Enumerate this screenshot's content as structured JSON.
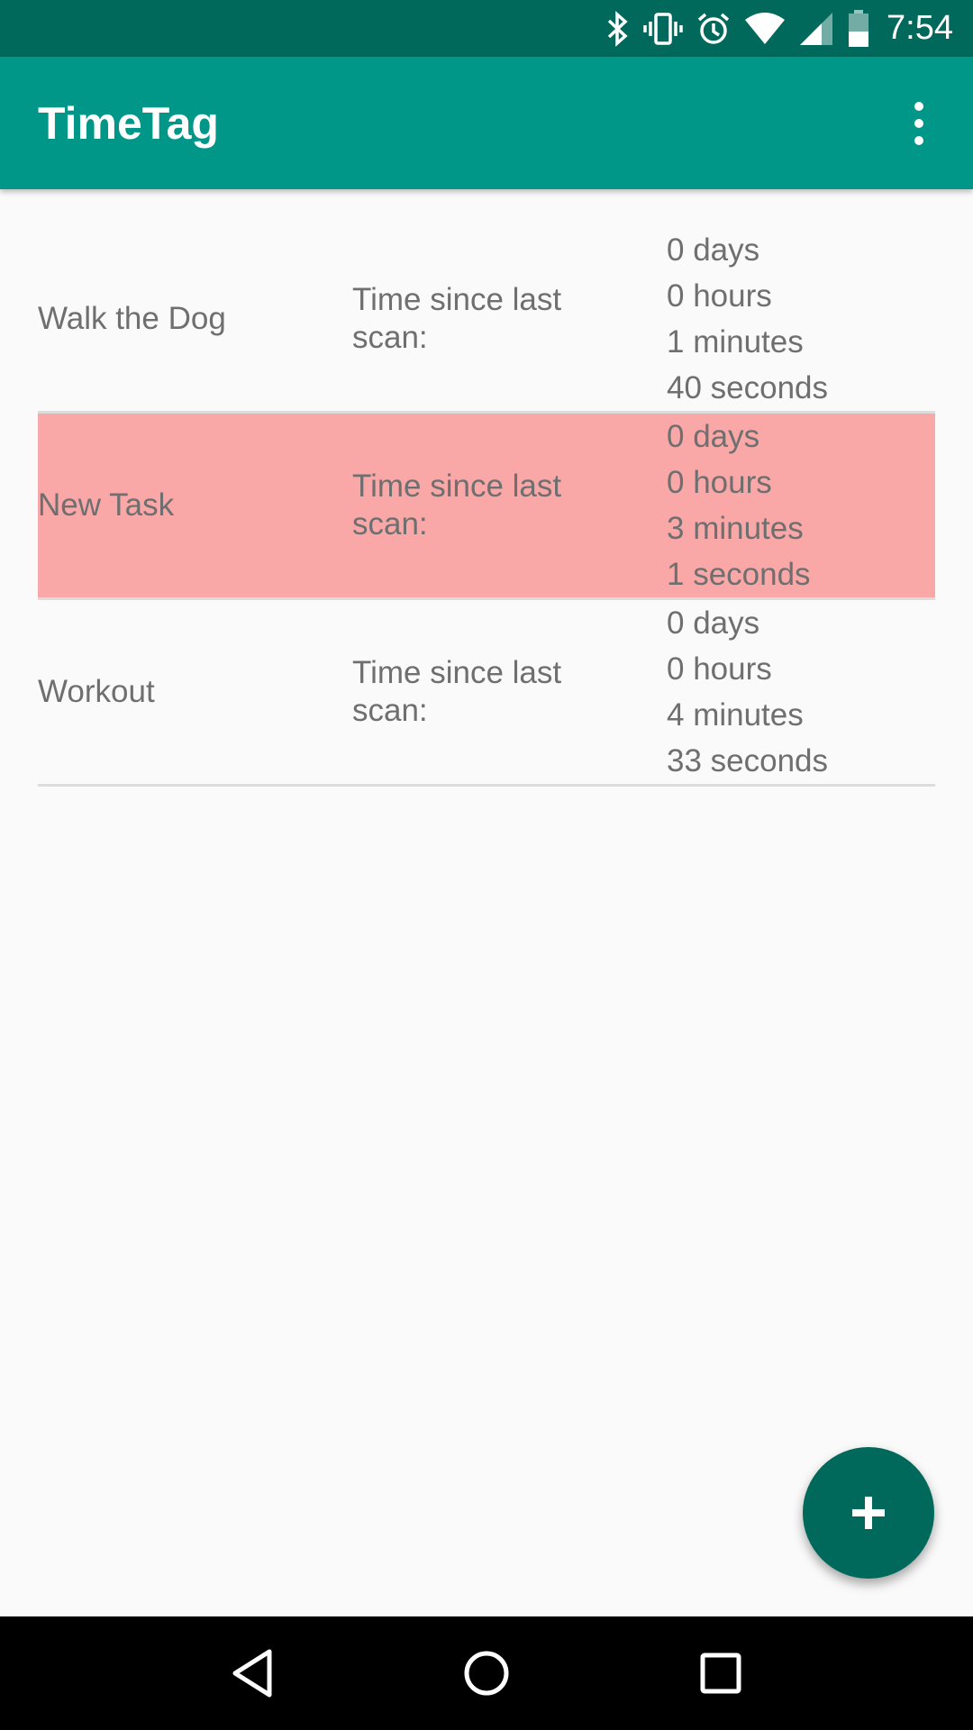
{
  "status_bar": {
    "time": "7:54",
    "icons": [
      "bluetooth-icon",
      "vibrate-icon",
      "alarm-icon",
      "wifi-icon",
      "cell-signal-icon",
      "battery-icon"
    ]
  },
  "app_bar": {
    "title": "TimeTag",
    "menu_icon": "overflow-menu-icon"
  },
  "tasks": [
    {
      "name": "Walk the Dog",
      "label": "Time since last scan:",
      "days": "0 days",
      "hours": "0 hours",
      "minutes": "1 minutes",
      "seconds": "40 seconds",
      "highlighted": false
    },
    {
      "name": "New Task",
      "label": "Time since last scan:",
      "days": "0 days",
      "hours": "0 hours",
      "minutes": "3 minutes",
      "seconds": "1 seconds",
      "highlighted": true
    },
    {
      "name": "Workout",
      "label": "Time since last scan:",
      "days": "0 days",
      "hours": "0 hours",
      "minutes": "4 minutes",
      "seconds": "33 seconds",
      "highlighted": false
    }
  ],
  "fab": {
    "icon": "plus-icon"
  },
  "nav_bar": {
    "icons": [
      "back-icon",
      "home-icon",
      "recents-icon"
    ]
  },
  "colors": {
    "status_bar": "#00695c",
    "app_bar": "#009688",
    "highlight_row": "#f9a7a7",
    "fab": "#00695c"
  }
}
